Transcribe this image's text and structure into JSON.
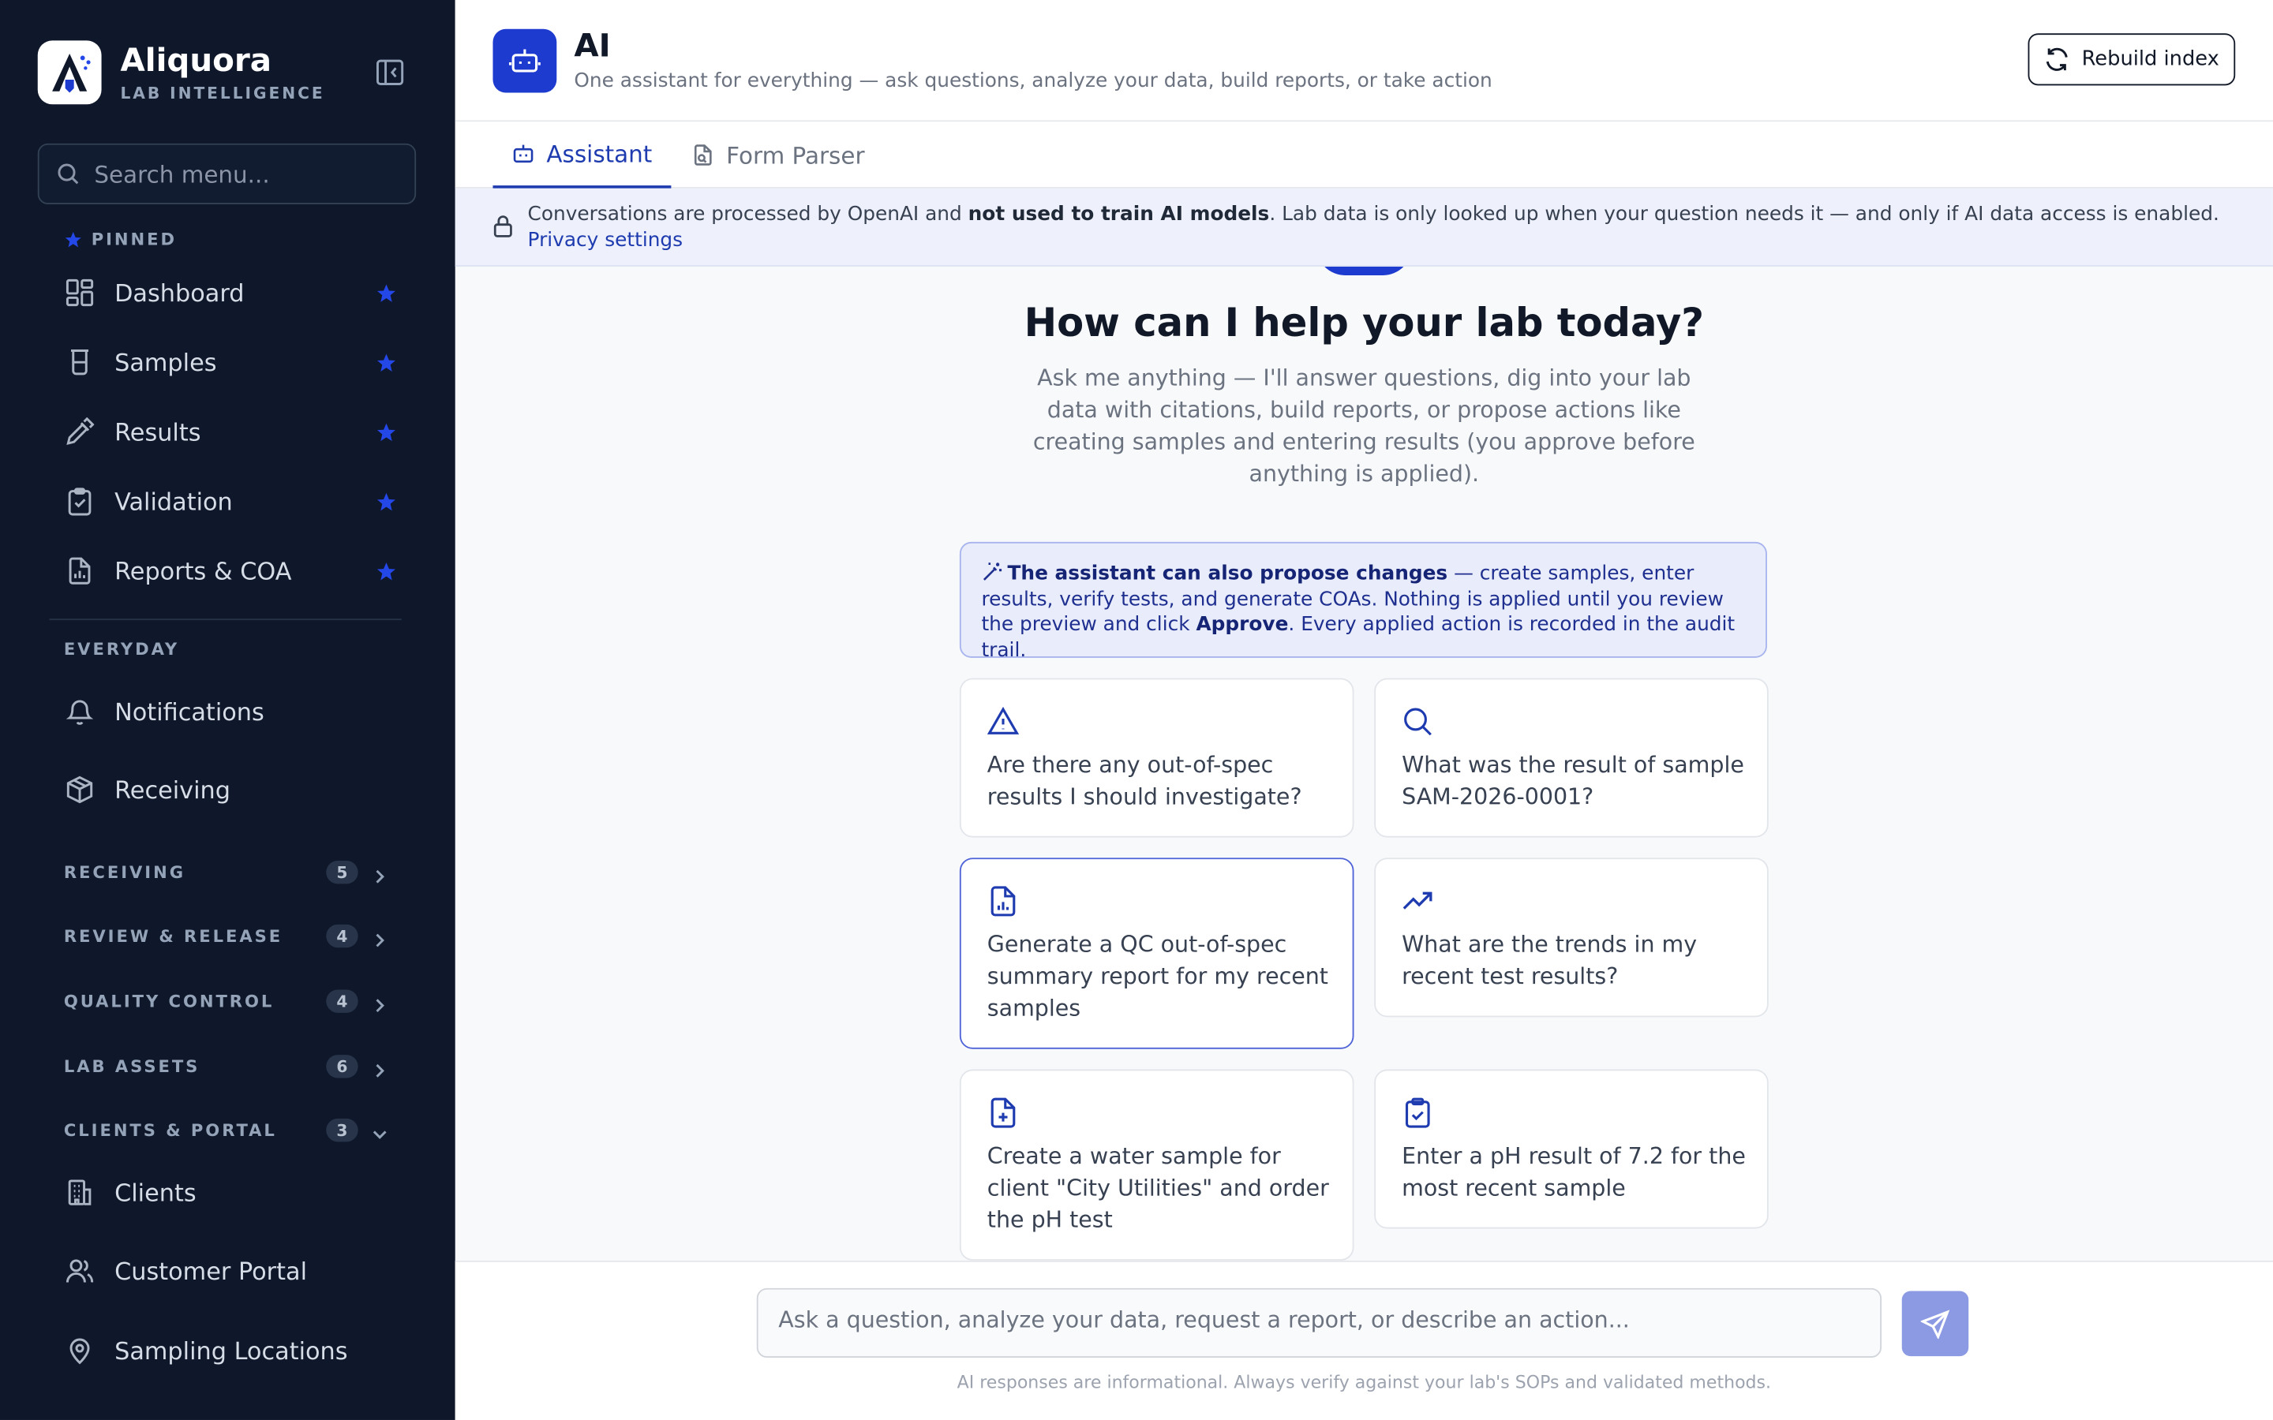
{
  "sidebar": {
    "brand_name": "Aliquora",
    "brand_sub": "LAB INTELLIGENCE",
    "search_placeholder": "Search menu...",
    "pinned_label": "PINNED",
    "pinned": [
      {
        "label": "Dashboard",
        "icon": "grid-icon"
      },
      {
        "label": "Samples",
        "icon": "beaker-icon"
      },
      {
        "label": "Results",
        "icon": "pipette-icon"
      },
      {
        "label": "Validation",
        "icon": "clipboard-check-icon"
      },
      {
        "label": "Reports & COA",
        "icon": "file-chart-icon"
      }
    ],
    "everyday_label": "EVERYDAY",
    "everyday": [
      {
        "label": "Notifications",
        "icon": "bell-icon"
      },
      {
        "label": "Receiving",
        "icon": "package-icon"
      }
    ],
    "groups": [
      {
        "label": "RECEIVING",
        "count": "5",
        "expanded": false
      },
      {
        "label": "REVIEW & RELEASE",
        "count": "4",
        "expanded": false
      },
      {
        "label": "QUALITY CONTROL",
        "count": "4",
        "expanded": false
      },
      {
        "label": "LAB ASSETS",
        "count": "6",
        "expanded": false
      },
      {
        "label": "CLIENTS & PORTAL",
        "count": "3",
        "expanded": true
      }
    ],
    "clients_items": [
      {
        "label": "Clients",
        "icon": "building-icon"
      },
      {
        "label": "Customer Portal",
        "icon": "users-icon"
      },
      {
        "label": "Sampling Locations",
        "icon": "map-pin-icon"
      }
    ]
  },
  "header": {
    "title": "AI",
    "subtitle": "One assistant for everything — ask questions, analyze your data, build reports, or take action",
    "rebuild_label": "Rebuild index"
  },
  "tabs": [
    {
      "label": "Assistant",
      "active": true
    },
    {
      "label": "Form Parser",
      "active": false
    }
  ],
  "notice": {
    "before": "Conversations are processed by OpenAI and ",
    "bold": "not used to train AI models",
    "after": ". Lab data is only looked up when your question needs it — and only if AI data access is enabled.",
    "link": "Privacy settings"
  },
  "welcome": {
    "title": "How can I help your lab today?",
    "subtitle": "Ask me anything — I'll answer questions, dig into your lab data with citations, build reports, or propose actions like creating samples and entering results (you approve before anything is applied)."
  },
  "propose": {
    "bold1": "The assistant can also propose changes",
    "text1": " — create samples, enter results, verify tests, and generate COAs. Nothing is applied until you review the preview and click ",
    "bold2": "Approve",
    "text2": ". Every applied action is recorded in the audit trail."
  },
  "suggestions": [
    {
      "text": "Are there any out-of-spec results I should investigate?",
      "icon": "alert-triangle-icon"
    },
    {
      "text": "What was the result of sample SAM-2026-0001?",
      "icon": "search-icon"
    },
    {
      "text": "Generate a QC out-of-spec summary report for my recent samples",
      "icon": "file-chart-icon"
    },
    {
      "text": "What are the trends in my recent test results?",
      "icon": "trending-up-icon"
    },
    {
      "text": "Create a water sample for client \"City Utilities\" and order the pH test",
      "icon": "file-plus-icon"
    },
    {
      "text": "Enter a pH result of 7.2 for the most recent sample",
      "icon": "clipboard-check-icon"
    }
  ],
  "composer": {
    "placeholder": "Ask a question, analyze your data, request a report, or describe an action...",
    "disclaimer": "AI responses are informational. Always verify against your lab's SOPs and validated methods."
  },
  "colors": {
    "sidebar_bg": "#0f172a",
    "accent": "#1e3bd0",
    "star": "#2447e8"
  }
}
